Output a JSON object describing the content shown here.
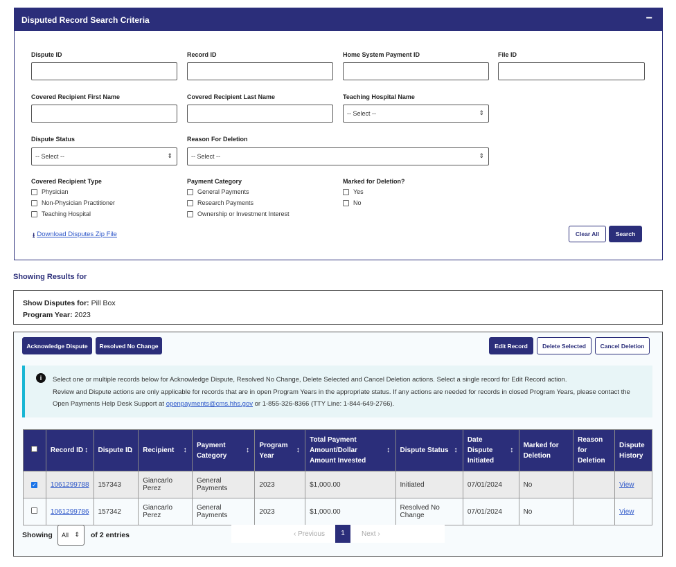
{
  "search": {
    "title": "Disputed Record Search Criteria",
    "collapse": "−",
    "dispute_id": "Dispute ID",
    "record_id": "Record ID",
    "home_payment_id": "Home System Payment ID",
    "file_id": "File ID",
    "first_name": "Covered Recipient First Name",
    "last_name": "Covered Recipient Last Name",
    "teaching_hospital": "Teaching Hospital Name",
    "dispute_status": "Dispute Status",
    "reason_deletion": "Reason For Deletion",
    "select": "-- Select --",
    "recipient_type": {
      "label": "Covered Recipient Type",
      "options": [
        "Physician",
        "Non-Physician Practitioner",
        "Teaching Hospital"
      ]
    },
    "payment_category": {
      "label": "Payment Category",
      "options": [
        "General Payments",
        "Research Payments",
        "Ownership or Investment Interest"
      ]
    },
    "marked_deletion": {
      "label": "Marked for Deletion?",
      "options": [
        "Yes",
        "No"
      ]
    },
    "download": "Download Disputes Zip File",
    "clear": "Clear All",
    "search": "Search"
  },
  "results_heading": "Showing Results for",
  "summary": {
    "disputes_label": "Show Disputes for:",
    "disputes_value": "Pill Box",
    "year_label": "Program Year:",
    "year_value": "2023"
  },
  "actions": {
    "acknowledge": "Acknowledge Dispute",
    "resolved": "Resolved No Change",
    "edit": "Edit Record",
    "delete": "Delete Selected",
    "cancel_deletion": "Cancel Deletion"
  },
  "info": {
    "line1": "Select one or multiple records below for Acknowledge Dispute, Resolved No Change, Delete Selected and Cancel Deletion actions. Select a single record for Edit Record action.",
    "line2a": "Review and Dispute actions are only applicable for records that are in open Program Years in the appropriate status. If any actions are needed for records in closed Program Years, please contact the Open Payments Help Desk Support at ",
    "email": "openpayments@cms.hhs.gov",
    "line2b": " or 1-855-326-8366 (TTY Line: 1-844-649-2766)."
  },
  "table": {
    "headers": [
      "Record ID",
      "Dispute ID",
      "Recipient",
      "Payment Category",
      "Program Year",
      "Total Payment Amount/Dollar Amount Invested",
      "Dispute Status",
      "Date Dispute Initiated",
      "Marked for Deletion",
      "Reason for Deletion",
      "Dispute History"
    ],
    "rows": [
      {
        "checked": true,
        "record_id": "1061299788",
        "dispute_id": "157343",
        "recipient": "Giancarlo Perez",
        "category": "General Payments",
        "year": "2023",
        "amount": "$1,000.00",
        "status": "Initiated",
        "date": "07/01/2024",
        "marked": "No",
        "reason": "",
        "history": "View"
      },
      {
        "checked": false,
        "record_id": "1061299786",
        "dispute_id": "157342",
        "recipient": "Giancarlo Perez",
        "category": "General Payments",
        "year": "2023",
        "amount": "$1,000.00",
        "status": "Resolved No Change",
        "date": "07/01/2024",
        "marked": "No",
        "reason": "",
        "history": "View"
      }
    ]
  },
  "pagination": {
    "showing": "Showing",
    "page_size": "All",
    "entries": "of 2 entries",
    "previous": "‹ Previous",
    "page": "1",
    "next": "Next ›"
  }
}
